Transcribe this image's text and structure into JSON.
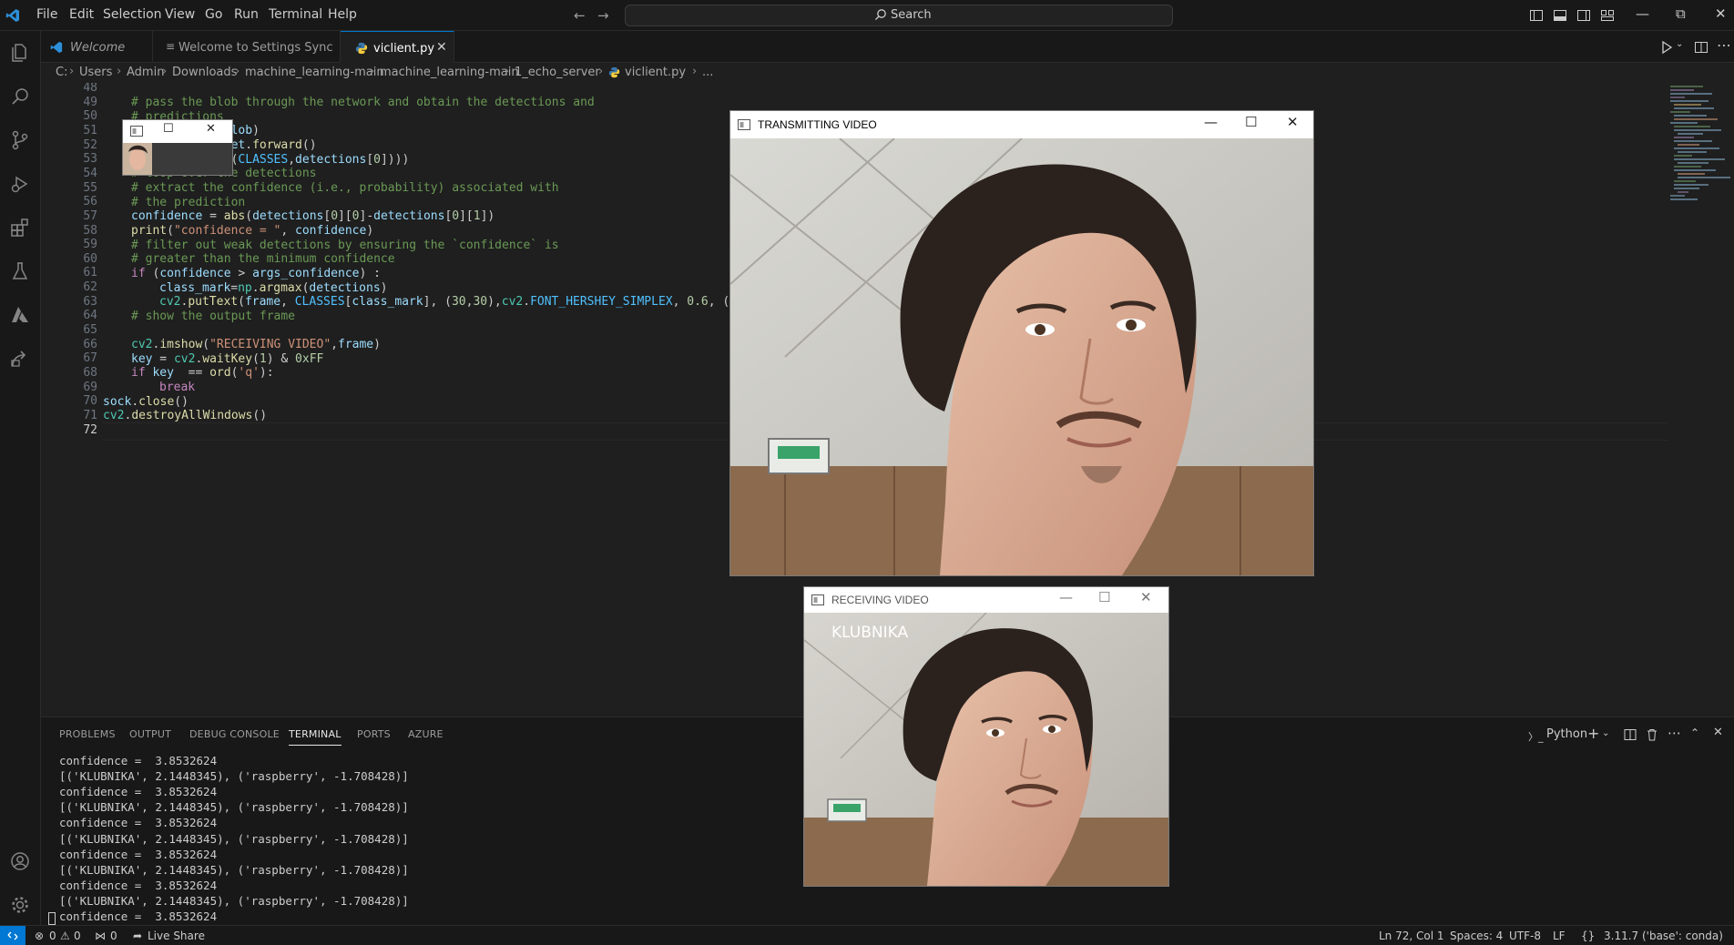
{
  "titlebar": {
    "menu": [
      "File",
      "Edit",
      "Selection",
      "View",
      "Go",
      "Run",
      "Terminal",
      "Help"
    ],
    "search_placeholder": "Search"
  },
  "tabs": [
    {
      "label": "Welcome",
      "icon": "vscode-icon"
    },
    {
      "label": "Welcome to Settings Sync",
      "icon": "document-icon"
    },
    {
      "label": "viclient.py",
      "icon": "python-icon",
      "active": true
    }
  ],
  "breadcrumb": [
    "C:",
    "Users",
    "Admin",
    "Downloads",
    "machine_learning-main",
    "machine_learning-main",
    "1_echo_server",
    "viclient.py",
    "..."
  ],
  "editor": {
    "line_numbers": [
      "48",
      "49",
      "50",
      "51",
      "52",
      "53",
      "54",
      "55",
      "56",
      "57",
      "58",
      "59",
      "60",
      "61",
      "62",
      "63",
      "64",
      "65",
      "66",
      "67",
      "68",
      "69",
      "70",
      "71",
      "72"
    ],
    "current_line": "72"
  },
  "panel": {
    "tabs": [
      "PROBLEMS",
      "OUTPUT",
      "DEBUG CONSOLE",
      "TERMINAL",
      "PORTS",
      "AZURE"
    ],
    "active_tab": "TERMINAL",
    "shell": "Python",
    "terminal_lines": [
      "confidence =  3.8532624",
      "[('KLUBNIKA', 2.1448345), ('raspberry', -1.708428)]",
      "confidence =  3.8532624",
      "[('KLUBNIKA', 2.1448345), ('raspberry', -1.708428)]",
      "confidence =  3.8532624",
      "[('KLUBNIKA', 2.1448345), ('raspberry', -1.708428)]",
      "confidence =  3.8532624",
      "[('KLUBNIKA', 2.1448345), ('raspberry', -1.708428)]",
      "confidence =  3.8532624",
      "[('KLUBNIKA', 2.1448345), ('raspberry', -1.708428)]",
      "confidence =  3.8532624"
    ]
  },
  "statusbar": {
    "problems": "0",
    "warnings": "0",
    "ports": "0",
    "live_share": "Live Share",
    "cursor": "Ln 72, Col 1",
    "spaces": "Spaces: 4",
    "encoding": "UTF-8",
    "eol": "LF",
    "interpreter": "3.11.7 ('base': conda)"
  },
  "windows": {
    "transmitting_title": "TRANSMITTING VIDEO",
    "receiving_title": "RECEIVING VIDEO",
    "overlay_label": "KLUBNIKA"
  },
  "colors": {
    "accent": "#0078d4",
    "editor_bg": "#1f1f1f",
    "chrome_bg": "#181818"
  }
}
